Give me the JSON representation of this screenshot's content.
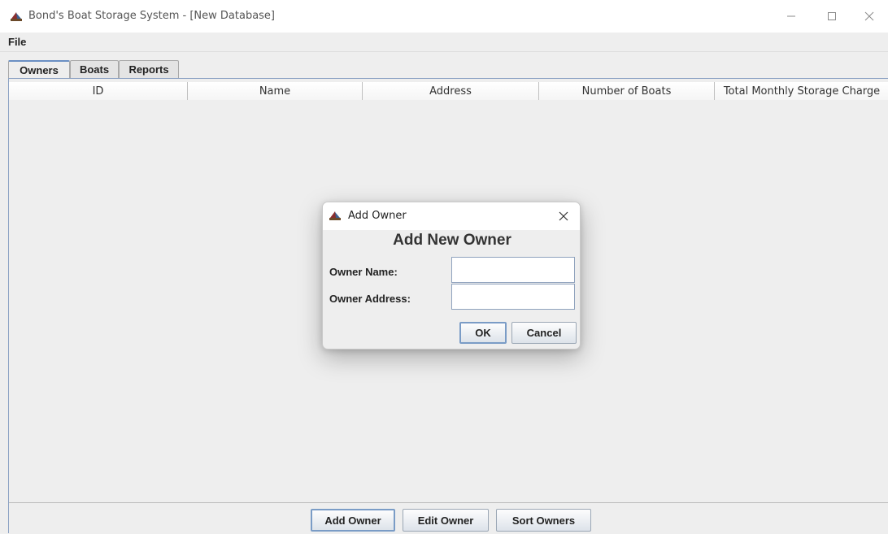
{
  "window": {
    "title": "Bond's Boat Storage System - [New Database]",
    "icon": "boat-app-icon",
    "controls": {
      "minimize": "minimize-icon",
      "maximize": "maximize-icon",
      "close": "close-icon"
    }
  },
  "menu": {
    "file_label": "File"
  },
  "tabs": [
    {
      "label": "Owners",
      "active": true
    },
    {
      "label": "Boats",
      "active": false
    },
    {
      "label": "Reports",
      "active": false
    }
  ],
  "table": {
    "columns": [
      "ID",
      "Name",
      "Address",
      "Number of Boats",
      "Total Monthly Storage Charge"
    ],
    "rows": []
  },
  "actions": {
    "add_owner": "Add Owner",
    "edit_owner": "Edit Owner",
    "sort_owners": "Sort Owners"
  },
  "dialog": {
    "title": "Add Owner",
    "heading": "Add New Owner",
    "name_label": "Owner Name:",
    "name_value": "",
    "address_label": "Owner Address:",
    "address_value": "",
    "ok_label": "OK",
    "cancel_label": "Cancel"
  },
  "colors": {
    "accent_border": "#7a9cc6",
    "panel_border": "#8ca2c4"
  }
}
